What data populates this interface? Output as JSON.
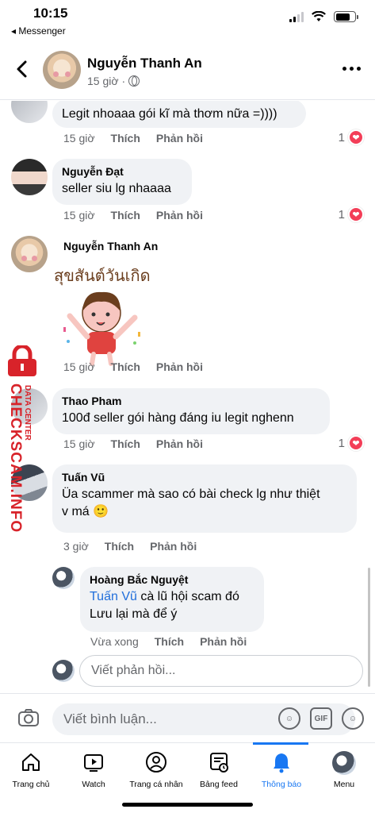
{
  "status_bar": {
    "time": "10:15",
    "back_app": "◂ Messenger",
    "battery_level": 0.75
  },
  "header": {
    "name": "Nguyễn Thanh An",
    "time": "15 giờ"
  },
  "comments": [
    {
      "text": "Legit nhoaaa gói kĩ mà thơm nữa =))))",
      "time": "15 giờ",
      "like": "Thích",
      "reply": "Phản hồi",
      "reactions": "1"
    },
    {
      "name": "Nguyễn Đạt",
      "text": "seller siu lg nhaaaa",
      "time": "15 giờ",
      "like": "Thích",
      "reply": "Phản hồi",
      "reactions": "1"
    },
    {
      "name": "Nguyễn Thanh An",
      "time": "15 giờ",
      "like": "Thích",
      "reply": "Phản hồi"
    },
    {
      "name": "Thao Pham",
      "text": "100đ seller gói hàng đáng iu legit nghenn",
      "time": "15 giờ",
      "like": "Thích",
      "reply": "Phản hồi",
      "reactions": "1"
    },
    {
      "name": "Tuấn Vũ",
      "text_line1": "Üa scammer mà sao có bài check lg như thiệt",
      "text_line2": "v má 🙂",
      "time": "3 giờ",
      "like": "Thích",
      "reply": "Phản hồi"
    },
    {
      "name": "Hoàng Bắc Nguyệt",
      "mention": "Tuấn Vũ",
      "text_line1": " cà lũ hội scam đó",
      "text_line2": "Lưu lại mà để ý",
      "time": "Vừa xong",
      "like": "Thích",
      "reply": "Phản hồi"
    }
  ],
  "sticker": {
    "caption": "สุขสันต์วันเกิด"
  },
  "watermark": {
    "big": "CHECKSCAM.INFO",
    "small": "DATA CENTER"
  },
  "reply_placeholder": "Viết phản hồi...",
  "composer": {
    "placeholder": "Viết bình luận...",
    "gif": "GIF"
  },
  "tabs": [
    {
      "label": "Trang chủ",
      "icon": "home-icon"
    },
    {
      "label": "Watch",
      "icon": "watch-icon"
    },
    {
      "label": "Trang cá nhân",
      "icon": "profile-icon"
    },
    {
      "label": "Bảng feed",
      "icon": "feed-icon"
    },
    {
      "label": "Thông báo",
      "icon": "bell-icon",
      "active": true
    },
    {
      "label": "Menu",
      "icon": "menu-avatar-icon"
    }
  ],
  "colors": {
    "accent": "#1877f2",
    "bubble": "#f0f2f5",
    "heart": "#f33e58",
    "watermark": "#d8232a",
    "link": "#216fdb"
  }
}
